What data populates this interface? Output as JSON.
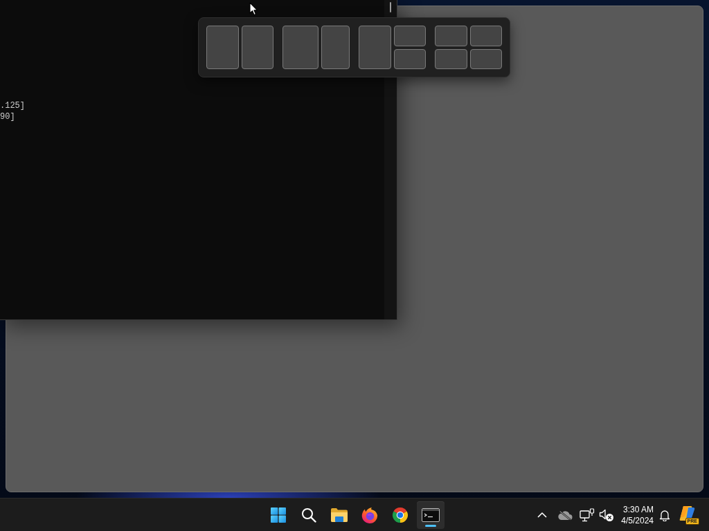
{
  "terminal": {
    "lines": [
      ".125]",
      "90]"
    ]
  },
  "snap_layouts": [
    {
      "kind": "halves"
    },
    {
      "kind": "wide-left"
    },
    {
      "kind": "left-stack"
    },
    {
      "kind": "quadrants"
    }
  ],
  "taskbar": {
    "apps": [
      {
        "kind": "start",
        "selected": false
      },
      {
        "kind": "search",
        "selected": false
      },
      {
        "kind": "folder",
        "selected": false
      },
      {
        "kind": "fox",
        "selected": false
      },
      {
        "kind": "wheel",
        "selected": false
      },
      {
        "kind": "console",
        "selected": true
      }
    ]
  },
  "tray": {
    "cloud_offline": true,
    "sound_muted": true,
    "time": "3:30 AM",
    "date": "4/5/2024",
    "copilot_badge": "PRE"
  }
}
